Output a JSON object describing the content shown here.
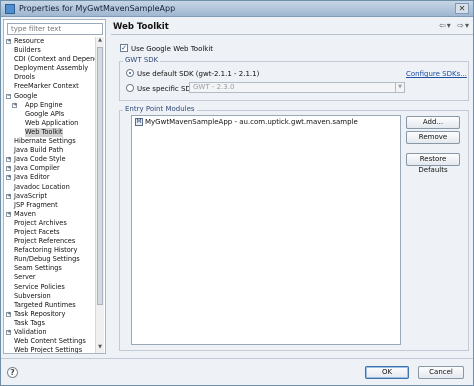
{
  "window": {
    "title": "Properties for MyGwtMavenSampleApp",
    "close_glyph": "✕",
    "icon": "properties-icon"
  },
  "filter": {
    "placeholder": "type filter text",
    "value": ""
  },
  "tree": {
    "items": [
      {
        "label": "Resource",
        "toggle": "+",
        "level": 1
      },
      {
        "label": "Builders",
        "toggle": "",
        "level": 1
      },
      {
        "label": "CDI (Context and Depend",
        "toggle": "",
        "level": 1
      },
      {
        "label": "Deployment Assembly",
        "toggle": "",
        "level": 1
      },
      {
        "label": "Drools",
        "toggle": "",
        "level": 1
      },
      {
        "label": "FreeMarker Context",
        "toggle": "",
        "level": 1
      },
      {
        "label": "Google",
        "toggle": "−",
        "level": 1
      },
      {
        "label": "App Engine",
        "toggle": "+",
        "level": 2
      },
      {
        "label": "Google APIs",
        "toggle": "",
        "level": 2
      },
      {
        "label": "Web Application",
        "toggle": "",
        "level": 2
      },
      {
        "label": "Web Toolkit",
        "toggle": "",
        "level": 2,
        "selected": true
      },
      {
        "label": "Hibernate Settings",
        "toggle": "",
        "level": 1
      },
      {
        "label": "Java Build Path",
        "toggle": "",
        "level": 1
      },
      {
        "label": "Java Code Style",
        "toggle": "+",
        "level": 1
      },
      {
        "label": "Java Compiler",
        "toggle": "+",
        "level": 1
      },
      {
        "label": "Java Editor",
        "toggle": "+",
        "level": 1
      },
      {
        "label": "Javadoc Location",
        "toggle": "",
        "level": 1
      },
      {
        "label": "JavaScript",
        "toggle": "+",
        "level": 1
      },
      {
        "label": "JSP Fragment",
        "toggle": "",
        "level": 1
      },
      {
        "label": "Maven",
        "toggle": "+",
        "level": 1
      },
      {
        "label": "Project Archives",
        "toggle": "",
        "level": 1
      },
      {
        "label": "Project Facets",
        "toggle": "",
        "level": 1
      },
      {
        "label": "Project References",
        "toggle": "",
        "level": 1
      },
      {
        "label": "Refactoring History",
        "toggle": "",
        "level": 1
      },
      {
        "label": "Run/Debug Settings",
        "toggle": "",
        "level": 1
      },
      {
        "label": "Seam Settings",
        "toggle": "",
        "level": 1
      },
      {
        "label": "Server",
        "toggle": "",
        "level": 1
      },
      {
        "label": "Service Policies",
        "toggle": "",
        "level": 1
      },
      {
        "label": "Subversion",
        "toggle": "",
        "level": 1
      },
      {
        "label": "Targeted Runtimes",
        "toggle": "",
        "level": 1
      },
      {
        "label": "Task Repository",
        "toggle": "+",
        "level": 1
      },
      {
        "label": "Task Tags",
        "toggle": "",
        "level": 1
      },
      {
        "label": "Validation",
        "toggle": "+",
        "level": 1
      },
      {
        "label": "Web Content Settings",
        "toggle": "",
        "level": 1
      },
      {
        "label": "Web Project Settings",
        "toggle": "",
        "level": 1
      }
    ]
  },
  "page": {
    "title": "Web Toolkit",
    "nav": {
      "back": "⇦",
      "back_menu": "▾",
      "forward": "⇨",
      "forward_menu": "▾"
    },
    "use_gwt": {
      "label": "Use Google Web Toolkit",
      "checked": true,
      "mark": "✓"
    },
    "gwt_sdk": {
      "group_label": "GWT SDK",
      "default_label": "Use default SDK (gwt-2.1.1 - 2.1.1)",
      "specific_label": "Use specific SDK:",
      "specific_value": "GWT - 2.3.0",
      "configure_link": "Configure SDKs...",
      "selected": "default"
    },
    "entry_points": {
      "group_label": "Entry Point Modules",
      "items": [
        {
          "label": "MyGwtMavenSampleApp - au.com.uptick.gwt.maven.sample",
          "icon": "gwt-module-icon"
        }
      ],
      "add_label": "Add...",
      "remove_label": "Remove",
      "restore_label": "Restore Defaults"
    }
  },
  "footer": {
    "help": "?",
    "ok_label": "OK",
    "cancel_label": "Cancel"
  },
  "colors": {
    "accent": "#1f52a5",
    "selection": "#d4d4d4",
    "dialog_bg": "#eef1f5"
  },
  "scroll_glyphs": {
    "up": "▲",
    "down": "▼",
    "dropdown": "▼"
  }
}
